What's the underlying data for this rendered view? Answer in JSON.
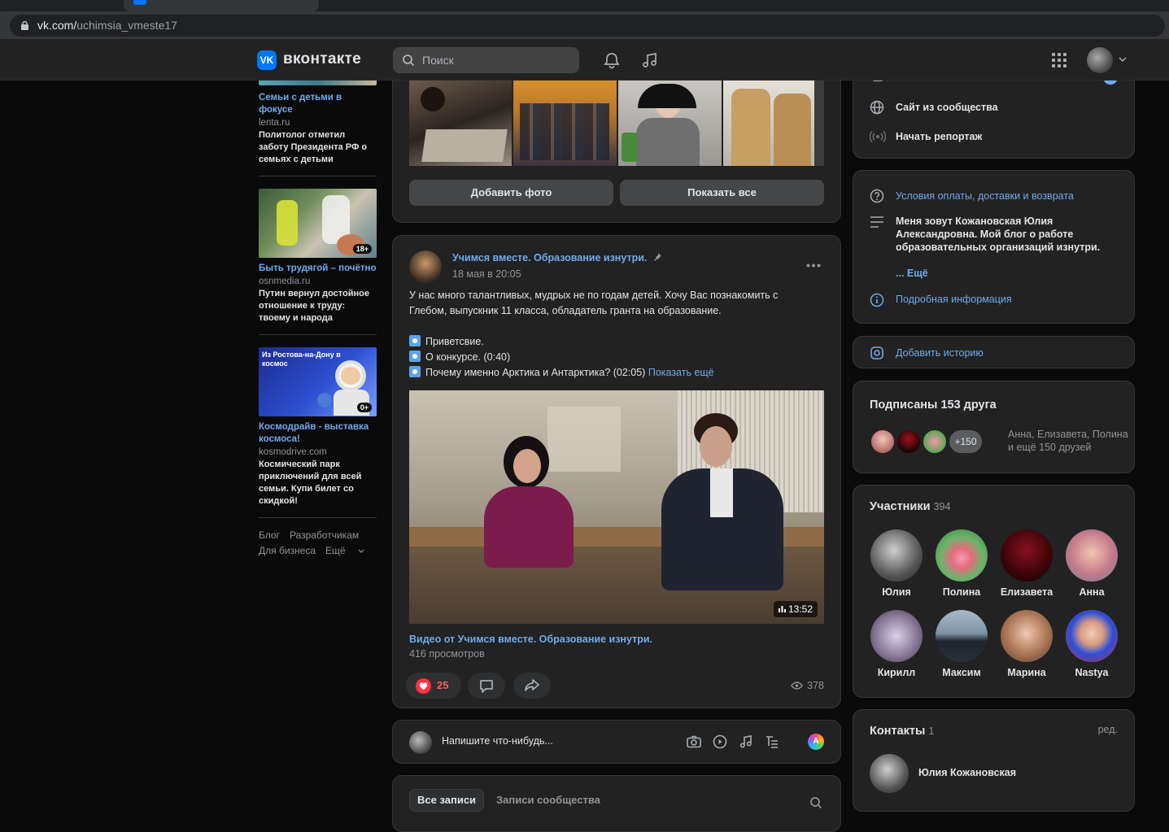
{
  "browser": {
    "url_domain": "vk.com/",
    "url_path": "uchimsia_vmeste17"
  },
  "header": {
    "logo_mark": "VK",
    "logo_text": "вконтакте",
    "search_placeholder": "Поиск",
    "icons": [
      "bell-icon",
      "music-icon",
      "apps-grid-icon",
      "avatar",
      "chevron-down-icon"
    ]
  },
  "ads": [
    {
      "title": "Семьи с детьми в фокусе",
      "source": "lenta.ru",
      "description": "Политолог отметил заботу Президента РФ о семьях с детьми"
    },
    {
      "title": "Быть трудягой – почётно",
      "source": "osnmedia.ru",
      "description": "Путин вернул достойное отношение к труду: твоему и народа",
      "age_badge": "18+"
    },
    {
      "title": "Космодрайв - выставка космоса!",
      "source": "kosmodrive.com",
      "description": "Космический парк приключений для всей семьи. Купи билет со скидкой!",
      "image_caption": "Из Ростова-на-Дону в космос",
      "age_badge": "0+"
    }
  ],
  "footer": {
    "links_row1": [
      "Блог",
      "Разработчикам"
    ],
    "links_row2": [
      "Для бизнеса",
      "Ещё"
    ]
  },
  "photos": {
    "add_photo": "Добавить фото",
    "show_all": "Показать все"
  },
  "post": {
    "author": "Учимся вместе. Образование изнутри.",
    "date": "18 мая в 20:05",
    "text_line1": "У нас много талантливых, мудрых не по годам детей. Хочу Вас познакомить с",
    "text_line2": "Глебом, выпускник 11 класса, обладатель гранта на образование.",
    "items": [
      "Приветсвие.",
      "О конкурсе. (0:40)",
      "Почему именно Арктика и Антарктика? (02:05)"
    ],
    "show_more": "Показать ещё",
    "video_duration": "13:52",
    "video_title": "Видео от Учимся вместе. Образование изнутри.",
    "video_views": "416 просмотров",
    "likes": "25",
    "views": "378"
  },
  "composer": {
    "placeholder": "Напишите что-нибудь..."
  },
  "wall_tabs": {
    "all": "Все записи",
    "community": "Записи сообщества"
  },
  "right": {
    "site_link": "Сайт из сообщества",
    "start_report": "Начать репортаж",
    "terms": "Условия оплаты, доставки и возврата",
    "about_line1": "Меня зовут Кожановская Юлия",
    "about_line2": "Александровна. Мой блог о работе",
    "about_line3": "образовательных организаций изнутри.",
    "more": "... Ещё",
    "details": "Подробная информация",
    "add_story": "Добавить историю",
    "friends_title": "Подписаны 153 друга",
    "friends_plus": "+150",
    "friends_names_1": "Анна, Елизавета, Полина",
    "friends_names_2": "и ещё 150 друзей",
    "members_title": "Участники",
    "members_count": "394",
    "members": [
      "Юлия",
      "Полина",
      "Елизавета",
      "Анна",
      "Кирилл",
      "Максим",
      "Марина",
      "Nastya"
    ],
    "contacts_title": "Контакты",
    "contacts_count": "1",
    "contacts_edit": "ред.",
    "contact_name": "Юлия Кожановская"
  },
  "colors": {
    "accent_link": "#71aaeb",
    "brand_blue": "#0077ff",
    "like_red": "#ff3347",
    "card_bg": "#222222"
  }
}
